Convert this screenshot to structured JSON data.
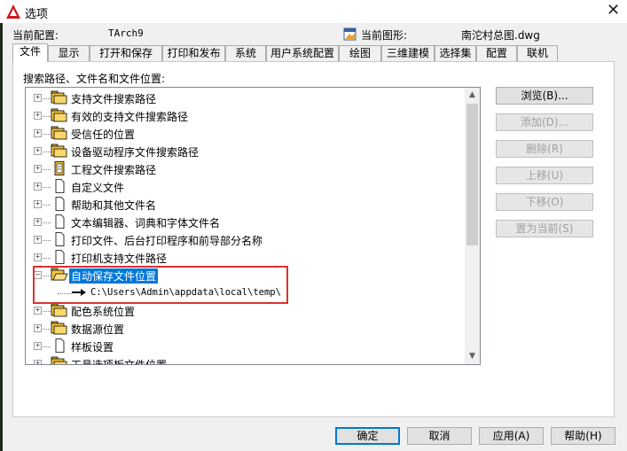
{
  "window": {
    "title": "选项",
    "close_glyph": "✕"
  },
  "profile": {
    "label": "当前配置:",
    "value": "TArch9"
  },
  "drawing": {
    "label": "当前图形:",
    "value": "南沱村总图.dwg"
  },
  "tabs": [
    {
      "label": "文件",
      "active": true
    },
    {
      "label": "显示"
    },
    {
      "label": "打开和保存"
    },
    {
      "label": "打印和发布"
    },
    {
      "label": "系统"
    },
    {
      "label": "用户系统配置"
    },
    {
      "label": "绘图"
    },
    {
      "label": "三维建模"
    },
    {
      "label": "选择集"
    },
    {
      "label": "配置"
    },
    {
      "label": "联机"
    }
  ],
  "section_label": "搜索路径、文件名和文件位置:",
  "tree": [
    {
      "label": "支持文件搜索路径",
      "icon": "folder-icon",
      "expander": "+"
    },
    {
      "label": "有效的支持文件搜索路径",
      "icon": "folder-icon",
      "expander": "+"
    },
    {
      "label": "受信任的位置",
      "icon": "folder-icon",
      "expander": "+"
    },
    {
      "label": "设备驱动程序文件搜索路径",
      "icon": "folder-icon",
      "expander": "+"
    },
    {
      "label": "工程文件搜索路径",
      "icon": "project-file-icon",
      "expander": "+"
    },
    {
      "label": "自定义文件",
      "icon": "document-icon",
      "expander": "+"
    },
    {
      "label": "帮助和其他文件名",
      "icon": "document-icon",
      "expander": "+"
    },
    {
      "label": "文本编辑器、词典和字体文件名",
      "icon": "document-icon",
      "expander": "+"
    },
    {
      "label": "打印文件、后台打印程序和前导部分名称",
      "icon": "document-icon",
      "expander": "+"
    },
    {
      "label": "打印机支持文件路径",
      "icon": "document-icon",
      "expander": "+"
    },
    {
      "label": "自动保存文件位置",
      "icon": "open-folder-icon",
      "expander": "−",
      "selected": true
    },
    {
      "label": "C:\\Users\\Admin\\appdata\\local\\temp\\",
      "icon": "arrow-icon",
      "child": true
    },
    {
      "label": "配色系统位置",
      "icon": "folder-icon",
      "expander": "+"
    },
    {
      "label": "数据源位置",
      "icon": "folder-icon",
      "expander": "+"
    },
    {
      "label": "样板设置",
      "icon": "document-icon",
      "expander": "+"
    },
    {
      "label": "工具选项板文件位置",
      "icon": "folder-icon",
      "expander": "+"
    }
  ],
  "side_buttons": [
    {
      "label": "浏览(B)...",
      "enabled": true
    },
    {
      "label": "添加(D)...",
      "enabled": false
    },
    {
      "label": "删除(R)",
      "enabled": false
    },
    {
      "label": "上移(U)",
      "enabled": false
    },
    {
      "label": "下移(O)",
      "enabled": false
    },
    {
      "label": "置为当前(S)",
      "enabled": false
    }
  ],
  "bottom_buttons": [
    {
      "label": "确定",
      "default": true
    },
    {
      "label": "取消"
    },
    {
      "label": "应用(A)"
    },
    {
      "label": "帮助(H)"
    }
  ],
  "scrollbar": {
    "up_glyph": "▲",
    "down_glyph": "▼",
    "position_fraction": 0.0
  },
  "colors": {
    "selection": "#0078d7",
    "highlight_box": "#e03030",
    "folder": "#f5c542"
  }
}
